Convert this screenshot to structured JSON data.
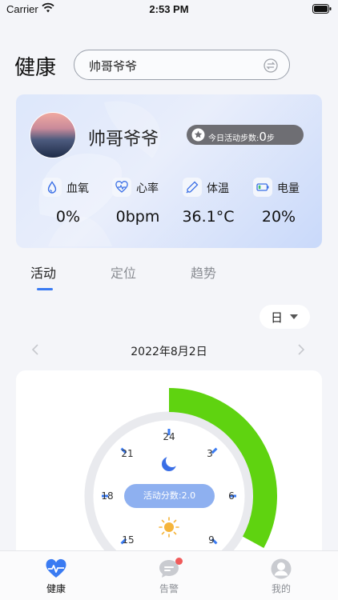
{
  "status_bar": {
    "carrier": "Carrier",
    "time": "2:53 PM"
  },
  "header": {
    "title": "健康",
    "search_value": "帅哥爷爷"
  },
  "profile": {
    "name": "帅哥爷爷",
    "steps_label": "今日活动步数:",
    "steps_value": "0",
    "steps_unit": "步",
    "stats": [
      {
        "label": "血氧",
        "value": "0%",
        "icon": "blood-drop-icon"
      },
      {
        "label": "心率",
        "value": "0bpm",
        "icon": "heart-rate-icon"
      },
      {
        "label": "体温",
        "value": "36.1°C",
        "icon": "thermometer-icon"
      },
      {
        "label": "电量",
        "value": "20%",
        "icon": "battery-icon"
      }
    ]
  },
  "tabs": [
    {
      "label": "活动",
      "active": true
    },
    {
      "label": "定位",
      "active": false
    },
    {
      "label": "趋势",
      "active": false
    }
  ],
  "range": {
    "selected": "日"
  },
  "date": "2022年8月2日",
  "clock": {
    "score_text": "活动分数:2.0",
    "hour_labels": [
      "24",
      "3",
      "6",
      "9",
      "15",
      "18",
      "21"
    ],
    "activity_fraction": 0.33,
    "colors": {
      "activity": "#5fd310",
      "ring": "#e9eaee",
      "tick": "#3a7bf2",
      "moon": "#3a6fe6",
      "sun": "#f5b43a"
    }
  },
  "bottom_nav": [
    {
      "label": "健康",
      "icon": "heart-pulse-icon",
      "active": true
    },
    {
      "label": "告警",
      "icon": "chat-alert-icon",
      "active": false
    },
    {
      "label": "我的",
      "icon": "user-icon",
      "active": false
    }
  ]
}
